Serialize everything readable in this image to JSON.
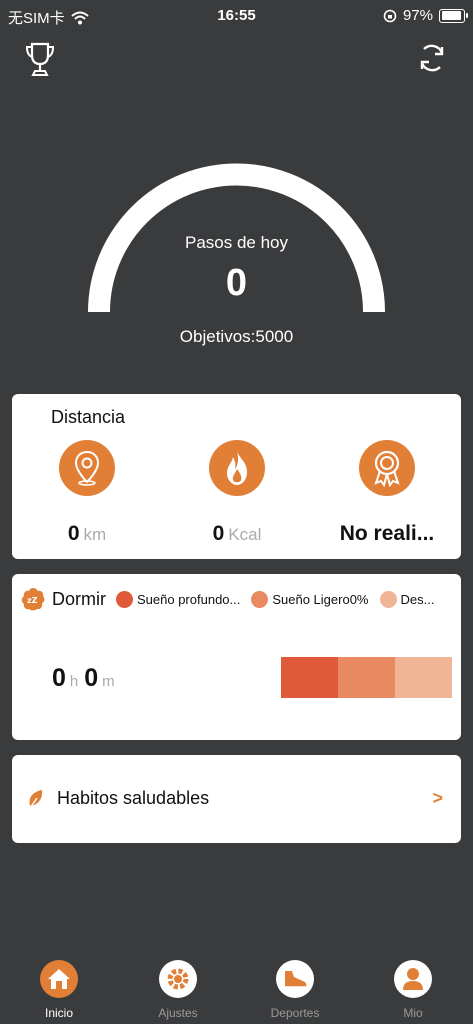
{
  "status_bar": {
    "carrier": "无SIM卡",
    "time": "16:55",
    "battery": "97%"
  },
  "top_icons": {
    "left": "trophy-icon",
    "right": "sync-icon"
  },
  "steps": {
    "title": "Pasos de hoy",
    "value": "0",
    "goal_label": "Objetivos:",
    "goal_value": "5000"
  },
  "distance_card": {
    "title": "Distancia",
    "metrics": [
      {
        "icon": "location-pin-icon",
        "value": "0",
        "unit": "km"
      },
      {
        "icon": "flame-icon",
        "value": "0",
        "unit": "Kcal"
      },
      {
        "icon": "award-badge-icon",
        "value": "No reali...",
        "unit": ""
      }
    ]
  },
  "sleep_card": {
    "title": "Dormir",
    "legend": [
      {
        "label": "Sueño profundo...",
        "color": "#e05a3a"
      },
      {
        "label": "Sueño Ligero0%",
        "color": "#e98a62"
      },
      {
        "label": "Des...",
        "color": "#f0b595"
      }
    ],
    "hours": "0",
    "hours_unit": "h",
    "minutes": "0",
    "minutes_unit": "m"
  },
  "habits_card": {
    "label": "Habitos saludables",
    "arrow": ">"
  },
  "tabbar": [
    {
      "label": "Inicio",
      "icon": "home-icon",
      "active": true
    },
    {
      "label": "Ajustes",
      "icon": "gear-icon",
      "active": false
    },
    {
      "label": "Deportes",
      "icon": "shoe-icon",
      "active": false
    },
    {
      "label": "Mio",
      "icon": "person-icon",
      "active": false
    }
  ],
  "colors": {
    "accent": "#e27f37",
    "background": "#3a3b3d",
    "card": "#ffffff"
  }
}
